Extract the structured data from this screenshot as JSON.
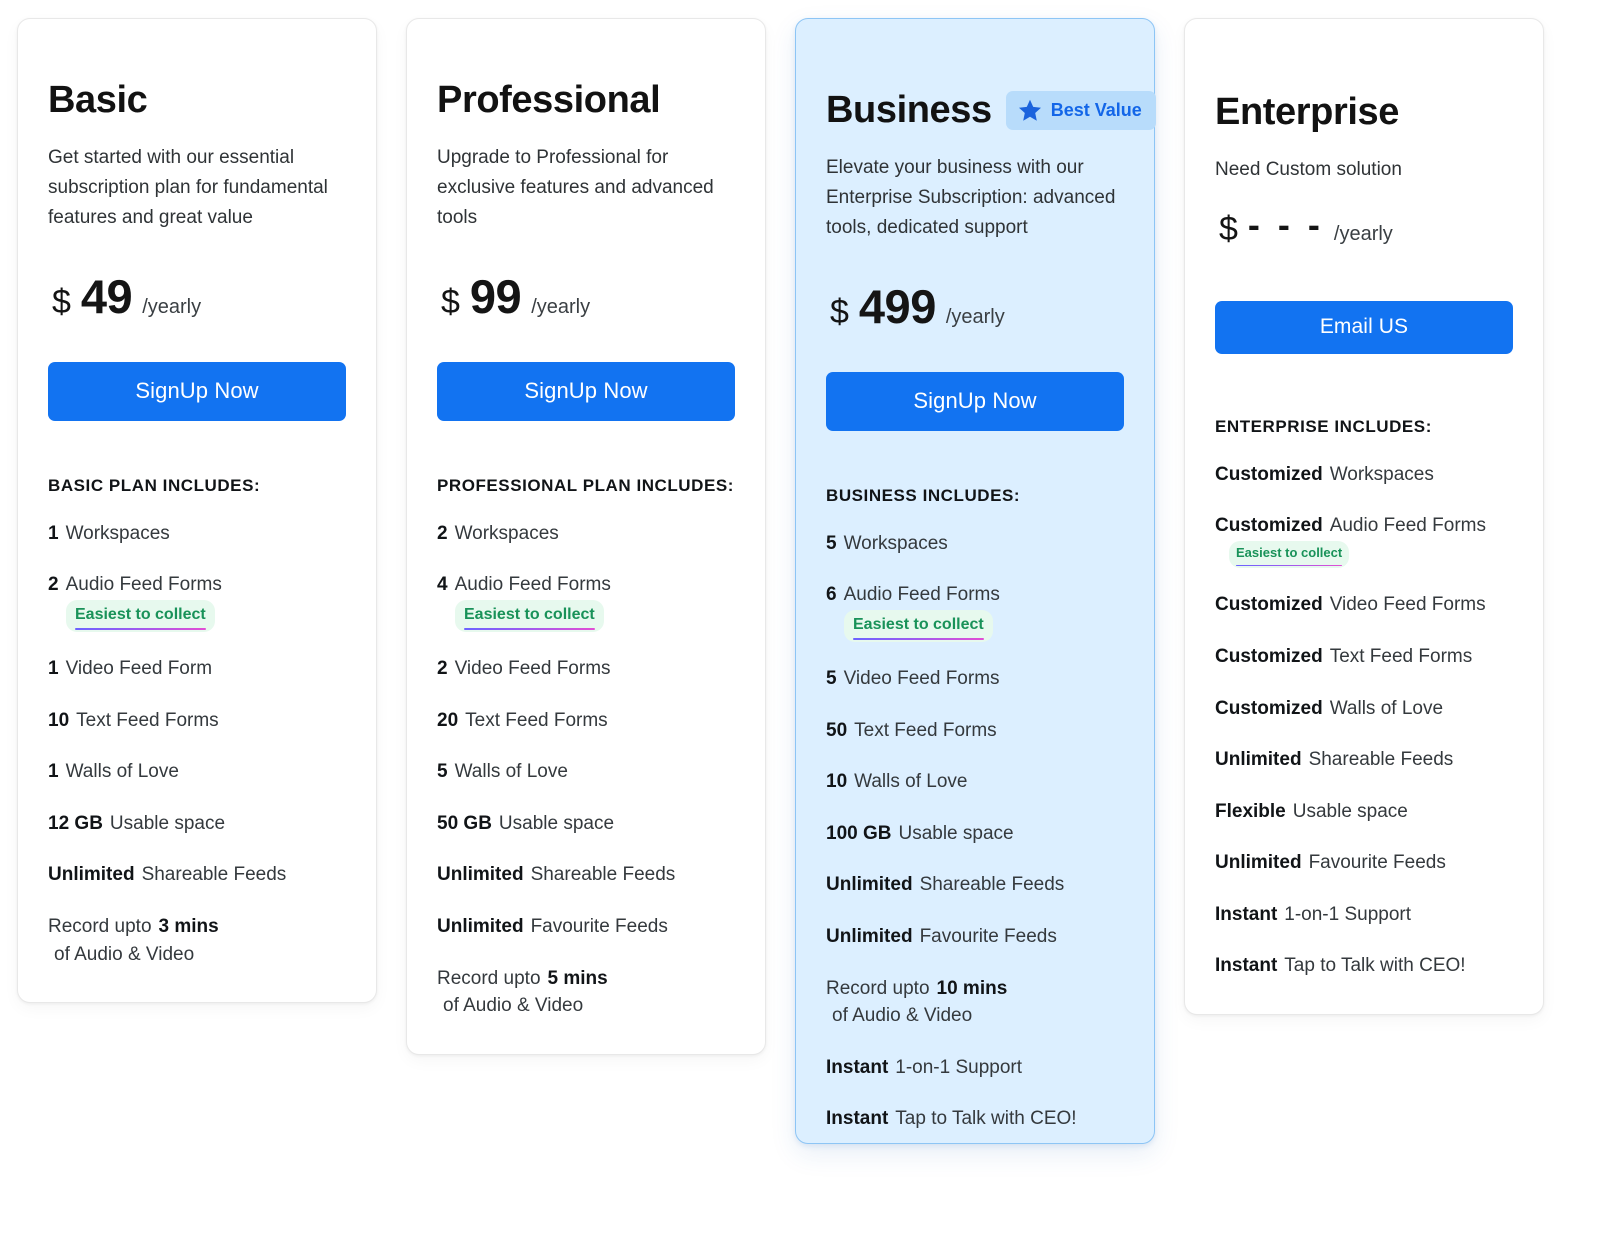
{
  "badges": {
    "best_value": "Best Value",
    "easiest_to_collect": "Easiest to collect"
  },
  "colors": {
    "accent": "#1273f1",
    "featured_bg": "#dcefff",
    "featured_border": "#8dc5f5",
    "best_value_bg": "#b8dcfb",
    "best_value_text": "#1366e8",
    "collect_bg": "#e7f9ee",
    "collect_text": "#199259",
    "card_border": "#e8e8e8"
  },
  "plans": [
    {
      "name": "Basic",
      "description": "Get started with our essential subscription plan for fundamental features and great value",
      "currency": "$",
      "amount": "49",
      "period": "/yearly",
      "cta_label": "SignUp Now",
      "includes_heading": "BASIC PLAN INCLUDES:",
      "features": [
        {
          "qty": "1",
          "text": "Workspaces"
        },
        {
          "qty": "2",
          "text": "Audio Feed Forms",
          "badge": "Easiest to collect"
        },
        {
          "qty": "1",
          "text": "Video Feed Form"
        },
        {
          "qty": "10",
          "text": "Text Feed Forms"
        },
        {
          "qty": "1",
          "text": "Walls of Love"
        },
        {
          "qty": "12 GB",
          "text": "Usable space"
        },
        {
          "qty": "Unlimited",
          "text": "Shareable Feeds"
        },
        {
          "lead": "Record upto",
          "qty": "3 mins",
          "tail": "of Audio & Video"
        }
      ]
    },
    {
      "name": "Professional",
      "description": "Upgrade to Professional for exclusive features and advanced tools",
      "currency": "$",
      "amount": "99",
      "period": "/yearly",
      "cta_label": "SignUp Now",
      "includes_heading": "PROFESSIONAL PLAN INCLUDES:",
      "features": [
        {
          "qty": "2",
          "text": "Workspaces"
        },
        {
          "qty": "4",
          "text": "Audio Feed Forms",
          "badge": "Easiest to collect"
        },
        {
          "qty": "2",
          "text": "Video Feed Forms"
        },
        {
          "qty": "20",
          "text": "Text Feed Forms"
        },
        {
          "qty": "5",
          "text": "Walls of Love"
        },
        {
          "qty": "50 GB",
          "text": "Usable space"
        },
        {
          "qty": "Unlimited",
          "text": "Shareable Feeds"
        },
        {
          "qty": "Unlimited",
          "text": "Favourite Feeds"
        },
        {
          "lead": "Record upto",
          "qty": "5 mins",
          "tail": "of Audio & Video"
        }
      ]
    },
    {
      "name": "Business",
      "featured": true,
      "badge": "Best Value",
      "description": "Elevate your business with our Enterprise Subscription: advanced tools, dedicated support",
      "currency": "$",
      "amount": "499",
      "period": "/yearly",
      "cta_label": "SignUp Now",
      "includes_heading": "BUSINESS INCLUDES:",
      "features": [
        {
          "qty": "5",
          "text": "Workspaces"
        },
        {
          "qty": "6",
          "text": "Audio Feed Forms",
          "badge": "Easiest to collect"
        },
        {
          "qty": "5",
          "text": "Video Feed Forms"
        },
        {
          "qty": "50",
          "text": "Text Feed Forms"
        },
        {
          "qty": "10",
          "text": "Walls of Love"
        },
        {
          "qty": "100 GB",
          "text": "Usable space"
        },
        {
          "qty": "Unlimited",
          "text": "Shareable Feeds"
        },
        {
          "qty": "Unlimited",
          "text": "Favourite Feeds"
        },
        {
          "lead": "Record upto",
          "qty": "10 mins",
          "tail": "of Audio & Video"
        },
        {
          "qty": "Instant",
          "text": "1-on-1 Support"
        },
        {
          "qty": "Instant",
          "text": "Tap to Talk with CEO!"
        }
      ]
    },
    {
      "name": "Enterprise",
      "description": "Need Custom solution",
      "currency": "$",
      "amount": "- - -",
      "period": "/yearly",
      "cta_label": "Email US",
      "includes_heading": "ENTERPRISE INCLUDES:",
      "features": [
        {
          "qty": "Customized",
          "text": "Workspaces"
        },
        {
          "qty": "Customized",
          "text": "Audio Feed Forms",
          "badge": "Easiest to collect",
          "badge_small": true
        },
        {
          "qty": "Customized",
          "text": "Video Feed Forms"
        },
        {
          "qty": "Customized",
          "text": "Text Feed Forms"
        },
        {
          "qty": "Customized",
          "text": "Walls of Love"
        },
        {
          "qty": "Unlimited",
          "text": "Shareable Feeds"
        },
        {
          "qty": "Flexible",
          "text": "Usable space"
        },
        {
          "qty": "Unlimited",
          "text": "Favourite Feeds"
        },
        {
          "qty": "Instant",
          "text": "1-on-1 Support"
        },
        {
          "qty": "Instant",
          "text": "Tap to Talk with CEO!"
        }
      ]
    }
  ]
}
